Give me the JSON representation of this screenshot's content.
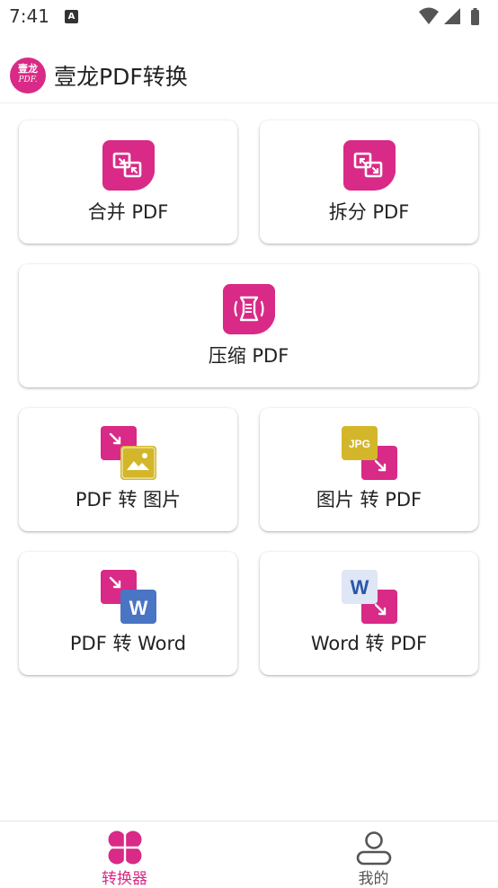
{
  "status_bar": {
    "time": "7:41",
    "notification_glyph": "A"
  },
  "app_bar": {
    "title": "壹龙PDF转换",
    "logo_line1": "壹龙",
    "logo_line2": "PDF."
  },
  "tools": {
    "merge": {
      "label": "合并 PDF",
      "icon": "merge-icon"
    },
    "split": {
      "label": "拆分 PDF",
      "icon": "split-icon"
    },
    "compress": {
      "label": "压缩 PDF",
      "icon": "compress-icon"
    },
    "pdf_to_image": {
      "label": "PDF 转 图片",
      "icon": "pdf-to-image-icon"
    },
    "image_to_pdf": {
      "label": "图片 转 PDF",
      "icon": "image-to-pdf-icon",
      "badge": "JPG"
    },
    "pdf_to_word": {
      "label": "PDF 转 Word",
      "icon": "pdf-to-word-icon",
      "badge": "W"
    },
    "word_to_pdf": {
      "label": "Word 转 PDF",
      "icon": "word-to-pdf-icon",
      "badge": "W"
    }
  },
  "bottom_nav": {
    "converter": {
      "label": "转换器",
      "active": true
    },
    "mine": {
      "label": "我的",
      "active": false
    }
  },
  "colors": {
    "accent": "#d82a86",
    "yellow": "#d4b62a",
    "word_blue": "#4a74c4",
    "word_light": "#dfe6f5",
    "text": "#222222",
    "inactive": "#555555"
  }
}
